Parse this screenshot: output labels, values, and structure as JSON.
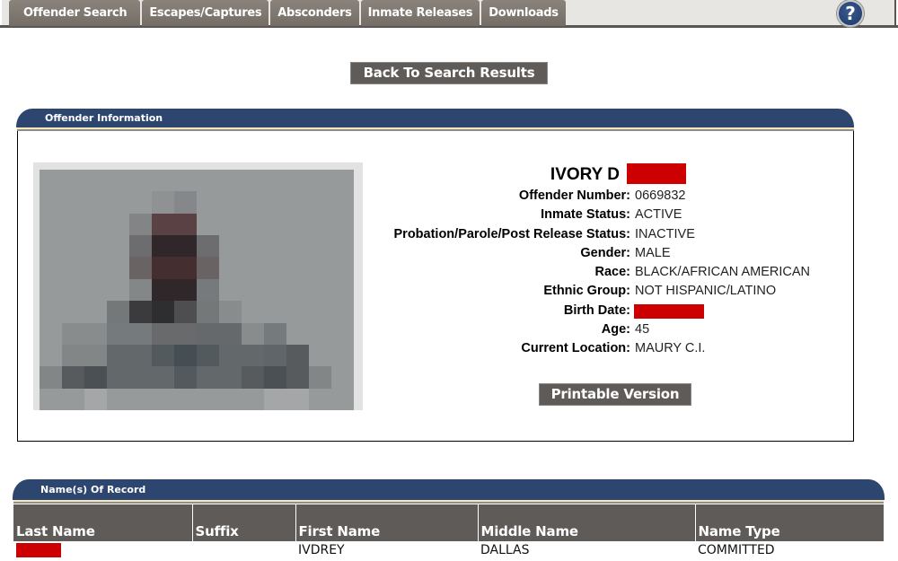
{
  "nav": {
    "tabs": [
      {
        "label": "Offender Search"
      },
      {
        "label": "Escapes/Captures"
      },
      {
        "label": "Absconders"
      },
      {
        "label": "Inmate Releases"
      },
      {
        "label": "Downloads"
      }
    ],
    "help_icon": "?"
  },
  "actions": {
    "back_label": "Back To Search Results",
    "print_label": "Printable Version"
  },
  "offender_info": {
    "section_title": "Offender Information",
    "photo": "pixelated-mugshot",
    "name_visible": "IVORY D",
    "name_redacted": true,
    "fields": [
      {
        "label": "Offender Number:",
        "value": "0669832"
      },
      {
        "label": "Inmate Status:",
        "value": "ACTIVE"
      },
      {
        "label": "Probation/Parole/Post Release Status:",
        "value": "INACTIVE"
      },
      {
        "label": "Gender:",
        "value": "MALE"
      },
      {
        "label": "Race:",
        "value": "BLACK/AFRICAN AMERICAN"
      },
      {
        "label": "Ethnic Group:",
        "value": "NOT HISPANIC/LATINO"
      },
      {
        "label": "Birth Date:",
        "value": "",
        "redacted": true
      },
      {
        "label": "Age:",
        "value": "45"
      },
      {
        "label": "Current Location:",
        "value": "MAURY C.I."
      }
    ]
  },
  "names_of_record": {
    "section_title": "Name(s) Of Record",
    "columns": [
      "Last Name",
      "Suffix",
      "First Name",
      "Middle Name",
      "Name Type"
    ],
    "rows": [
      {
        "last_name": "",
        "last_name_redacted": true,
        "suffix": "",
        "first_name": "IVDREY",
        "middle_name": "DALLAS",
        "name_type": "COMMITTED"
      }
    ]
  },
  "colors": {
    "header_blue": "#2c4670",
    "button_gray": "#5f5b59",
    "redaction_red": "#cc0000",
    "tab_brown_gray": "#7d766f"
  }
}
